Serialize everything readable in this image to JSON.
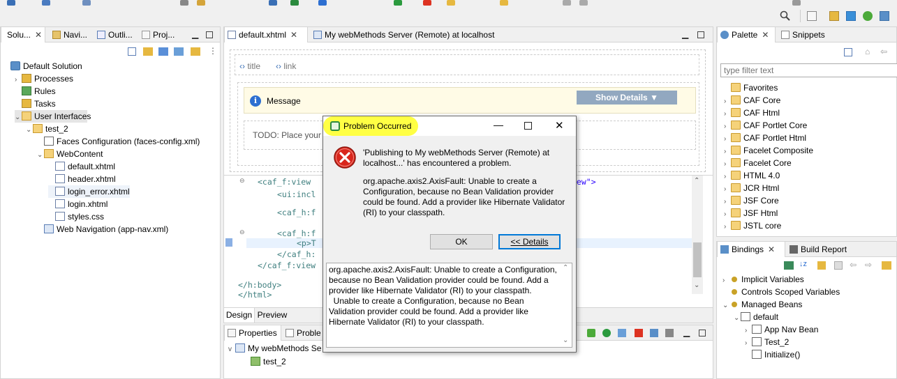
{
  "left_panel": {
    "tabs": [
      "Solu...",
      "Navi...",
      "Outli...",
      "Proj..."
    ],
    "tree": [
      {
        "label": "Default Solution",
        "depth": 0,
        "arrow": "",
        "icon": "solution-icon"
      },
      {
        "label": "Processes",
        "depth": 1,
        "arrow": ">",
        "icon": "processes-icon"
      },
      {
        "label": "Rules",
        "depth": 1,
        "arrow": "",
        "icon": "rules-icon"
      },
      {
        "label": "Tasks",
        "depth": 1,
        "arrow": "",
        "icon": "tasks-icon"
      },
      {
        "label": "User Interfaces",
        "depth": 1,
        "arrow": "v",
        "icon": "user-interfaces-icon"
      },
      {
        "label": "test_2",
        "depth": 2,
        "arrow": "v",
        "icon": "project-folder-icon"
      },
      {
        "label": "Faces Configuration (faces-config.xml)",
        "depth": 3,
        "arrow": "",
        "icon": "xml-file-icon"
      },
      {
        "label": "WebContent",
        "depth": 3,
        "arrow": "v",
        "icon": "folder-icon"
      },
      {
        "label": "default.xhtml",
        "depth": 4,
        "arrow": "",
        "icon": "xhtml-file-icon"
      },
      {
        "label": "header.xhtml",
        "depth": 4,
        "arrow": "",
        "icon": "xhtml-file-icon"
      },
      {
        "label": "login_error.xhtml",
        "depth": 4,
        "arrow": "",
        "icon": "xhtml-file-icon"
      },
      {
        "label": "login.xhtml",
        "depth": 4,
        "arrow": "",
        "icon": "xhtml-file-icon"
      },
      {
        "label": "styles.css",
        "depth": 4,
        "arrow": "",
        "icon": "css-file-icon"
      },
      {
        "label": "Web Navigation (app-nav.xml)",
        "depth": 3,
        "arrow": "",
        "icon": "nav-file-icon"
      }
    ]
  },
  "editor": {
    "tabs": [
      "default.xhtml",
      "My webMethods Server (Remote) at localhost"
    ],
    "breadcrumb": [
      "title",
      "link"
    ],
    "message_label": "Message",
    "show_details": "Show Details ▼",
    "todo_text": "TODO: Place your",
    "code_lines": [
      "<caf_f:view",
      "<ui:incl",
      "<caf_h:f",
      "<caf_h:f",
      "<p>T",
      "</caf_h:",
      "</caf_f:view",
      "</h:body>",
      "</html>"
    ],
    "code_right_fragment": "iew\">",
    "bottom_tabs": [
      "Design",
      "Preview"
    ]
  },
  "bottom_panel": {
    "tabs": [
      "Properties",
      "Proble"
    ],
    "tree": [
      "My webMethods Se",
      "test_2"
    ]
  },
  "palette": {
    "tabs": [
      "Palette",
      "Snippets"
    ],
    "filter_placeholder": "type filter text",
    "items": [
      "Favorites",
      "CAF Core",
      "CAF Html",
      "CAF Portlet Core",
      "CAF Portlet Html",
      "Facelet Composite",
      "Facelet Core",
      "HTML 4.0",
      "JCR Html",
      "JSF Core",
      "JSF Html",
      "JSTL core"
    ]
  },
  "bindings": {
    "tabs": [
      "Bindings",
      "Build Report"
    ],
    "tree": [
      {
        "label": "Implicit Variables",
        "depth": 0,
        "arrow": ">"
      },
      {
        "label": "Controls Scoped Variables",
        "depth": 0,
        "arrow": ""
      },
      {
        "label": "Managed Beans",
        "depth": 0,
        "arrow": "v"
      },
      {
        "label": "default",
        "depth": 1,
        "arrow": "v"
      },
      {
        "label": "App Nav Bean",
        "depth": 2,
        "arrow": ">"
      },
      {
        "label": "Test_2",
        "depth": 2,
        "arrow": ">"
      },
      {
        "label": "Initialize()",
        "depth": 2,
        "arrow": ""
      }
    ]
  },
  "dialog": {
    "title": "Problem Occurred",
    "message": "'Publishing to My webMethods Server (Remote) at localhost...' has encountered a problem.",
    "error_text": "org.apache.axis2.AxisFault: Unable to create a Configuration, because no Bean Validation provider could be found. Add a provider like Hibernate Validator (RI) to your classpath.",
    "ok_label": "OK",
    "details_label": "<< Details",
    "details_text": "org.apache.axis2.AxisFault: Unable to create a Configuration, because no Bean Validation provider could be found. Add a provider like Hibernate Validator (RI) to your classpath.\n  Unable to create a Configuration, because no Bean Validation provider could be found. Add a provider like Hibernate Validator (RI) to your classpath."
  }
}
